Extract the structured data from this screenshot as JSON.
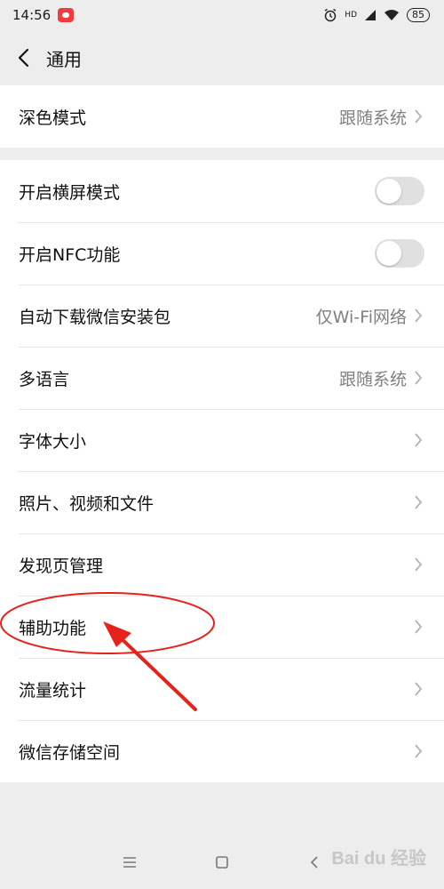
{
  "status_bar": {
    "time": "14:56",
    "network": "HD",
    "battery": "85"
  },
  "header": {
    "title": "通用"
  },
  "group1": [
    {
      "label": "深色模式",
      "value": "跟随系统"
    }
  ],
  "group2": [
    {
      "label": "开启横屏模式",
      "toggle": false
    },
    {
      "label": "开启NFC功能",
      "toggle": false
    },
    {
      "label": "自动下载微信安装包",
      "value": "仅Wi-Fi网络"
    },
    {
      "label": "多语言",
      "value": "跟随系统"
    },
    {
      "label": "字体大小"
    },
    {
      "label": "照片、视频和文件"
    },
    {
      "label": "发现页管理"
    },
    {
      "label": "辅助功能"
    },
    {
      "label": "流量统计"
    },
    {
      "label": "微信存储空间"
    }
  ],
  "watermark": "Bai du 经验",
  "colors": {
    "annotation": "#e5231b",
    "toggle_off": "#e0e0e0"
  }
}
